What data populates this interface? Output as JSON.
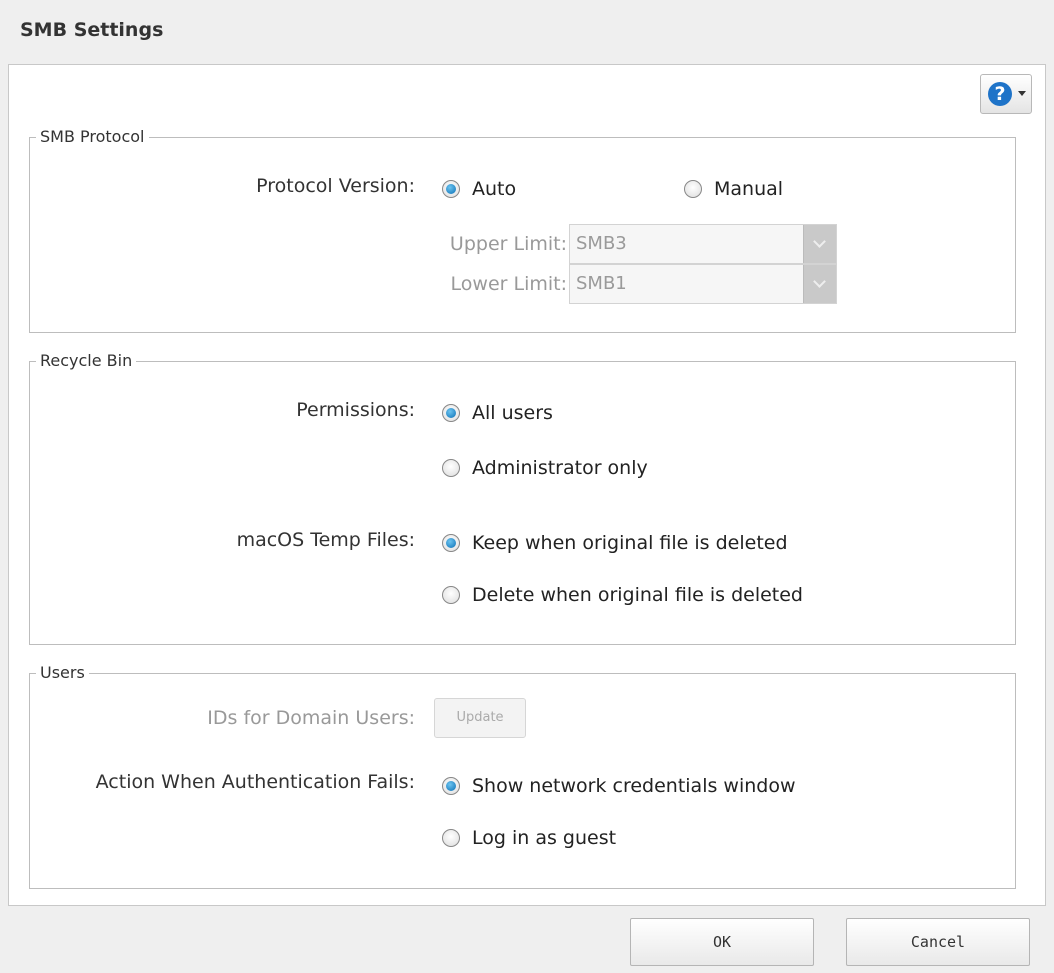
{
  "dialog": {
    "title": "SMB Settings"
  },
  "help": {
    "icon": "question-mark-icon",
    "glyph": "?"
  },
  "smb_protocol": {
    "legend": "SMB Protocol",
    "protocol_version_label": "Protocol Version:",
    "options": [
      {
        "label": "Auto",
        "selected": true
      },
      {
        "label": "Manual",
        "selected": false
      }
    ],
    "upper_limit_label": "Upper Limit:",
    "upper_limit_value": "SMB3",
    "lower_limit_label": "Lower Limit:",
    "lower_limit_value": "SMB1"
  },
  "recycle_bin": {
    "legend": "Recycle Bin",
    "permissions_label": "Permissions:",
    "permissions_options": [
      {
        "label": "All users",
        "selected": true
      },
      {
        "label": "Administrator only",
        "selected": false
      }
    ],
    "macos_label": "macOS Temp Files:",
    "macos_options": [
      {
        "label": "Keep when original file is deleted",
        "selected": true
      },
      {
        "label": "Delete when original file is deleted",
        "selected": false
      }
    ]
  },
  "users": {
    "legend": "Users",
    "domain_ids_label": "IDs for Domain Users:",
    "update_button": "Update",
    "auth_fail_label": "Action When Authentication Fails:",
    "auth_fail_options": [
      {
        "label": "Show network credentials window",
        "selected": true
      },
      {
        "label": "Log in as guest",
        "selected": false
      }
    ]
  },
  "footer": {
    "ok": "OK",
    "cancel": "Cancel"
  },
  "colors": {
    "accent": "#0a6fb5",
    "help_icon": "#1e73c8"
  }
}
